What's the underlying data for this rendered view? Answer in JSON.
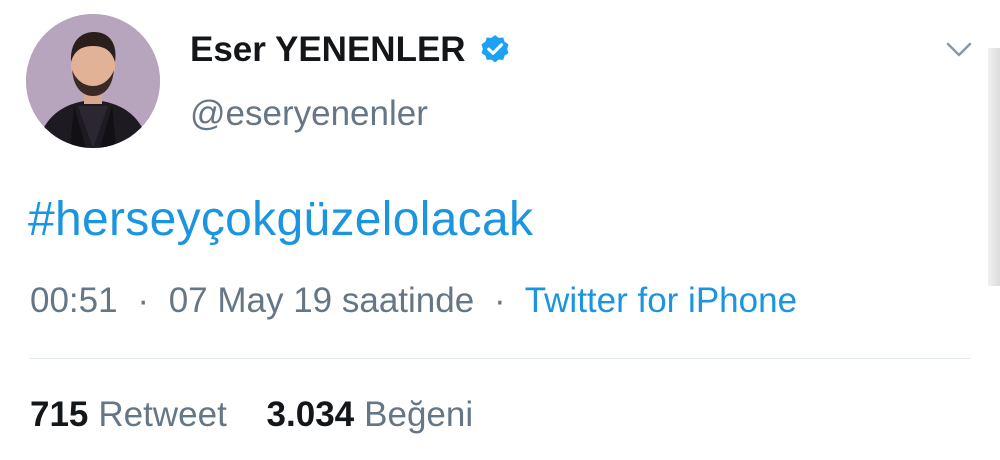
{
  "author": {
    "display_name": "Eser YENENLER",
    "handle": "@eseryenenler",
    "verified_icon": "verified-badge-icon",
    "avatar_icon": "avatar-photo"
  },
  "tweet": {
    "text": "#herseyçokgüzelolacak",
    "time": "00:51",
    "date": "07 May 19 saatinde",
    "separator": "·",
    "source": "Twitter for iPhone"
  },
  "stats": {
    "retweet_count": "715",
    "retweet_label": "Retweet",
    "like_count": "3.034",
    "like_label": "Beğeni"
  },
  "menu": {
    "icon": "chevron-down-icon"
  },
  "colors": {
    "link": "#1b95e0",
    "text_primary": "#14171a",
    "text_secondary": "#657786",
    "divider": "#e1e8ed"
  }
}
